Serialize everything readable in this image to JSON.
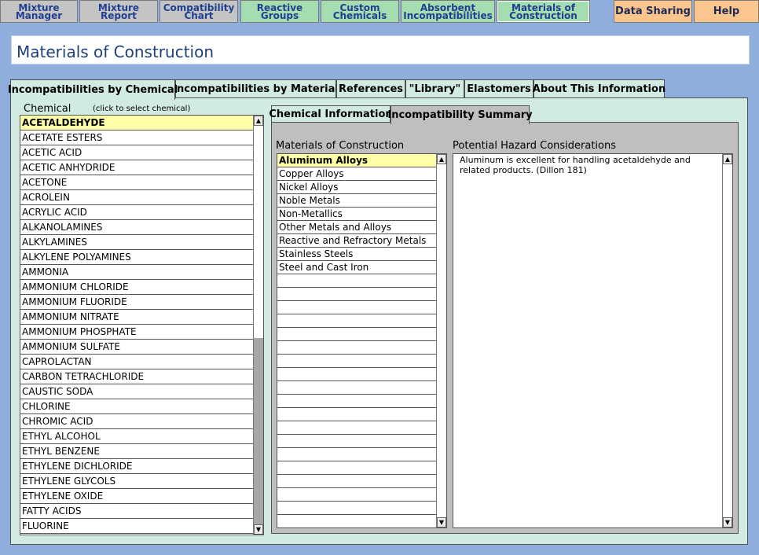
{
  "nav": {
    "mixture_manager": "Mixture\nManager",
    "mixture_report": "Mixture\nReport",
    "compatibility_chart": "Compatibility\nChart",
    "reactive_groups": "Reactive\nGroups",
    "custom_chemicals": "Custom\nChemicals",
    "absorbent_incompatibilities": "Absorbent\nIncompatibilities",
    "materials_of_construction": "Materials of\nConstruction",
    "data_sharing": "Data Sharing",
    "help": "Help"
  },
  "page": {
    "title": "Materials of Construction"
  },
  "tabs": {
    "by_chemical": "Incompatibilities by Chemical",
    "by_material": "Incompatibilities by Material",
    "references": "References",
    "library": "\"Library\"",
    "elastomers": "Elastomers",
    "about": "About This Information"
  },
  "chemical_panel": {
    "label": "Chemical",
    "hint": "(click to select chemical)",
    "items": [
      "ACETALDEHYDE",
      "ACETATE ESTERS",
      "ACETIC ACID",
      "ACETIC ANHYDRIDE",
      "ACETONE",
      "ACROLEIN",
      "ACRYLIC ACID",
      "ALKANOLAMINES",
      "ALKYLAMINES",
      "ALKYLENE POLYAMINES",
      "AMMONIA",
      "AMMONIUM CHLORIDE",
      "AMMONIUM FLUORIDE",
      "AMMONIUM NITRATE",
      "AMMONIUM PHOSPHATE",
      "AMMONIUM SULFATE",
      "CAPROLACTAN",
      "CARBON TETRACHLORIDE",
      "CAUSTIC SODA",
      "CHLORINE",
      "CHROMIC ACID",
      "ETHYL ALCOHOL",
      "ETHYL BENZENE",
      "ETHYLENE DICHLORIDE",
      "ETHYLENE GLYCOLS",
      "ETHYLENE OXIDE",
      "FATTY ACIDS",
      "FLUORINE"
    ],
    "selected_index": 0
  },
  "subtabs": {
    "chemical_information": "Chemical Information",
    "incompatibility_summary": "Incompatibility Summary"
  },
  "materials": {
    "label": "Materials of Construction",
    "items": [
      "Aluminum Alloys",
      "Copper Alloys",
      "Nickel Alloys",
      "Noble Metals",
      "Non-Metallics",
      "Other Metals and Alloys",
      "Reactive and Refractory Metals",
      "Stainless Steels",
      "Steel and Cast Iron"
    ],
    "selected_index": 0
  },
  "hazard": {
    "label": "Potential Hazard Considerations",
    "text": "Aluminum is excellent for handling acetaldehyde and related products.  (Dillon 181)"
  },
  "icons": {
    "scroll_up": "up-arrow-icon",
    "scroll_down": "down-arrow-icon"
  },
  "colors": {
    "background": "#8faedc",
    "nav_grey": "#c4c4c4",
    "nav_green": "#a4ddb0",
    "nav_orange": "#fbc58e",
    "panel": "#d2ebe2",
    "subpanel": "#bfbfbf",
    "selection": "#ffffa8",
    "title_text": "#1f3f78"
  }
}
